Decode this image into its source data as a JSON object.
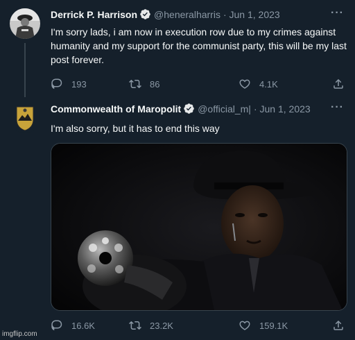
{
  "tweet1": {
    "name": "Derrick P. Harrison",
    "handle": "@heneralharris",
    "date": "· Jun 1, 2023",
    "text": "I'm sorry lads, i am now in execution row due to my crimes against humanity and my support for the communist party, this will be my last post forever.",
    "replies": "193",
    "retweets": "86",
    "likes": "4.1K"
  },
  "tweet2": {
    "name": "Commonwealth of Maropolit",
    "handle": "@official_m|",
    "date": "· Jun 1, 2023",
    "text": "I'm also sorry, but it has to end this way",
    "replies": "16.6K",
    "retweets": "23.2K",
    "likes": "159.1K"
  },
  "more_label": "···",
  "watermark": "imgflip.com",
  "colors": {
    "background": "#15202b",
    "text": "#f7f9f9",
    "secondary": "#8b98a5",
    "verified": "#1d9bf0"
  }
}
